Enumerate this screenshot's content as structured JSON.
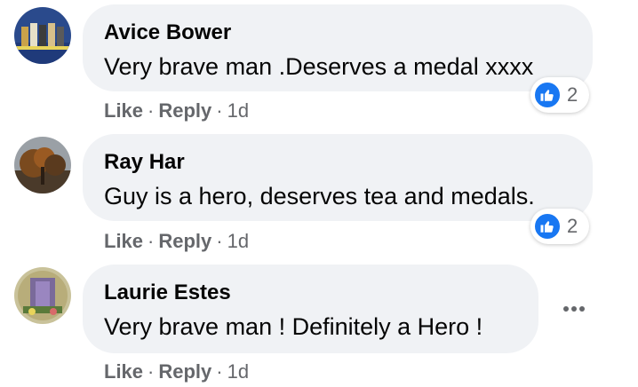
{
  "comments": [
    {
      "author": "Avice Bower",
      "text": "Very brave man .Deserves a medal xxxx",
      "like_label": "Like",
      "reply_label": "Reply",
      "time": "1d",
      "reaction_count": "2",
      "reaction_icon": "thumbs-up-icon"
    },
    {
      "author": "Ray Har",
      "text": "Guy is a hero, deserves tea and medals.",
      "like_label": "Like",
      "reply_label": "Reply",
      "time": "1d",
      "reaction_count": "2",
      "reaction_icon": "thumbs-up-icon"
    },
    {
      "author": "Laurie Estes",
      "text": "Very brave man ! Definitely a Hero !",
      "like_label": "Like",
      "reply_label": "Reply",
      "time": "1d",
      "more_icon": "more-options-icon"
    }
  ],
  "separator": "·",
  "colors": {
    "bubble": "#f0f2f5",
    "like_blue": "#1877f2",
    "secondary_text": "#65676b"
  }
}
